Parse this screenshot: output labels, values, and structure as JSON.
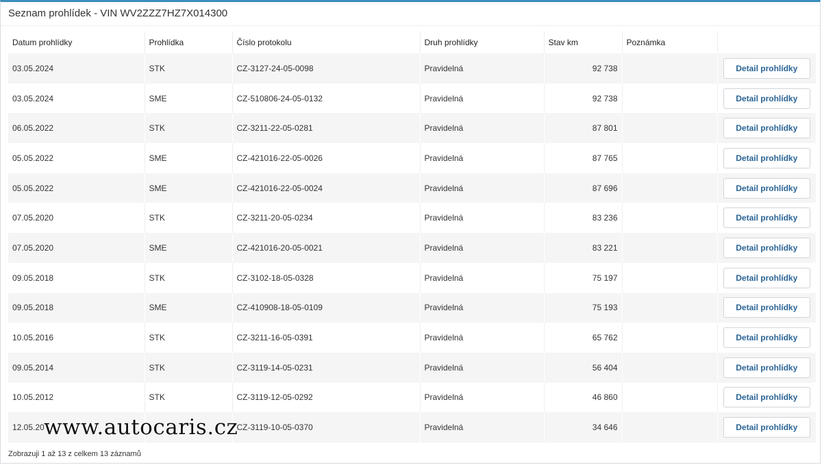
{
  "panel": {
    "title": "Seznam prohlídek - VIN WV2ZZZ7HZ7X014300"
  },
  "table": {
    "columns": [
      "Datum prohlídky",
      "Prohlídka",
      "Číslo protokolu",
      "Druh prohlídky",
      "Stav km",
      "Poznámka",
      ""
    ],
    "rows": [
      {
        "date": "03.05.2024",
        "type": "STK",
        "protocol": "CZ-3127-24-05-0098",
        "kind": "Pravidelná",
        "km": "92 738",
        "note": "",
        "action": "Detail prohlídky"
      },
      {
        "date": "03.05.2024",
        "type": "SME",
        "protocol": "CZ-510806-24-05-0132",
        "kind": "Pravidelná",
        "km": "92 738",
        "note": "",
        "action": "Detail prohlídky"
      },
      {
        "date": "06.05.2022",
        "type": "STK",
        "protocol": "CZ-3211-22-05-0281",
        "kind": "Pravidelná",
        "km": "87 801",
        "note": "",
        "action": "Detail prohlídky"
      },
      {
        "date": "05.05.2022",
        "type": "SME",
        "protocol": "CZ-421016-22-05-0026",
        "kind": "Pravidelná",
        "km": "87 765",
        "note": "",
        "action": "Detail prohlídky"
      },
      {
        "date": "05.05.2022",
        "type": "SME",
        "protocol": "CZ-421016-22-05-0024",
        "kind": "Pravidelná",
        "km": "87 696",
        "note": "",
        "action": "Detail prohlídky"
      },
      {
        "date": "07.05.2020",
        "type": "STK",
        "protocol": "CZ-3211-20-05-0234",
        "kind": "Pravidelná",
        "km": "83 236",
        "note": "",
        "action": "Detail prohlídky"
      },
      {
        "date": "07.05.2020",
        "type": "SME",
        "protocol": "CZ-421016-20-05-0021",
        "kind": "Pravidelná",
        "km": "83 221",
        "note": "",
        "action": "Detail prohlídky"
      },
      {
        "date": "09.05.2018",
        "type": "STK",
        "protocol": "CZ-3102-18-05-0328",
        "kind": "Pravidelná",
        "km": "75 197",
        "note": "",
        "action": "Detail prohlídky"
      },
      {
        "date": "09.05.2018",
        "type": "SME",
        "protocol": "CZ-410908-18-05-0109",
        "kind": "Pravidelná",
        "km": "75 193",
        "note": "",
        "action": "Detail prohlídky"
      },
      {
        "date": "10.05.2016",
        "type": "STK",
        "protocol": "CZ-3211-16-05-0391",
        "kind": "Pravidelná",
        "km": "65 762",
        "note": "",
        "action": "Detail prohlídky"
      },
      {
        "date": "09.05.2014",
        "type": "STK",
        "protocol": "CZ-3119-14-05-0231",
        "kind": "Pravidelná",
        "km": "56 404",
        "note": "",
        "action": "Detail prohlídky"
      },
      {
        "date": "10.05.2012",
        "type": "STK",
        "protocol": "CZ-3119-12-05-0292",
        "kind": "Pravidelná",
        "km": "46 860",
        "note": "",
        "action": "Detail prohlídky"
      },
      {
        "date": "12.05.20",
        "type": "",
        "protocol": "CZ-3119-10-05-0370",
        "kind": "Pravidelná",
        "km": "34 646",
        "note": "",
        "action": "Detail prohlídky"
      }
    ]
  },
  "footer": {
    "info": "Zobrazuji 1 až 13 z celkem 13 záznamů"
  },
  "watermark": {
    "text": "www.autocaris.cz"
  },
  "colors": {
    "accent": "#3c8dbc",
    "button_text": "#2a6496",
    "row_stripe": "#f5f5f5"
  }
}
